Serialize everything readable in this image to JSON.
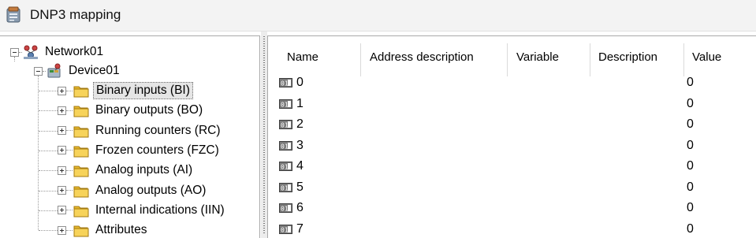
{
  "window": {
    "title": "DNP3 mapping",
    "icon": "dnp3-mapping-icon"
  },
  "tree": {
    "network": {
      "label": "Network01",
      "icon": "network-icon"
    },
    "device": {
      "label": "Device01",
      "icon": "device-icon"
    },
    "groups": [
      {
        "label": "Binary inputs (BI)",
        "selected": true,
        "icon": "folder-icon"
      },
      {
        "label": "Binary outputs (BO)",
        "icon": "folder-icon"
      },
      {
        "label": "Running counters (RC)",
        "icon": "folder-icon"
      },
      {
        "label": "Frozen counters (FZC)",
        "icon": "folder-icon"
      },
      {
        "label": "Analog inputs (AI)",
        "icon": "folder-icon"
      },
      {
        "label": "Analog outputs (AO)",
        "icon": "folder-icon"
      },
      {
        "label": "Internal indications (IIN)",
        "icon": "folder-icon"
      },
      {
        "label": "Attributes",
        "icon": "folder-icon"
      }
    ]
  },
  "grid": {
    "columns": [
      "Name",
      "Address description",
      "Variable",
      "Description",
      "Value"
    ],
    "rows": [
      {
        "name": "0",
        "value": "0"
      },
      {
        "name": "1",
        "value": "0"
      },
      {
        "name": "2",
        "value": "0"
      },
      {
        "name": "3",
        "value": "0"
      },
      {
        "name": "4",
        "value": "0"
      },
      {
        "name": "5",
        "value": "0"
      },
      {
        "name": "6",
        "value": "0"
      },
      {
        "name": "7",
        "value": "0"
      }
    ],
    "row_icon": "binary-io-icon"
  }
}
